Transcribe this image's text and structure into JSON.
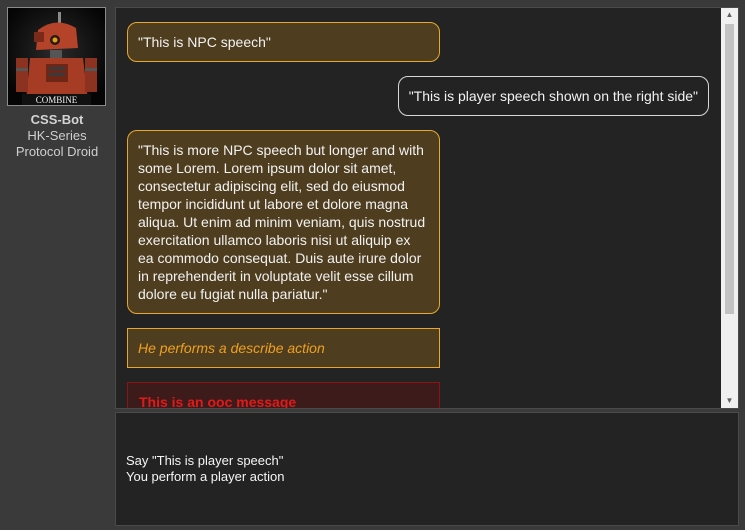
{
  "npc": {
    "avatar_icon": "droid-portrait-icon",
    "avatar_caption": "COMBINE",
    "name": "CSS-Bot",
    "series": "HK-Series",
    "role": "Protocol Droid"
  },
  "colors": {
    "npc_border": "#e8a82c",
    "npc_bg": "#4e3e1f",
    "action_text": "#f0a020",
    "ooc_text": "#e01a1a",
    "ooc_border": "#8b1515",
    "panel_bg": "#232323",
    "page_bg": "#3a3a3a"
  },
  "chat": {
    "messages": [
      {
        "type": "npc_speech",
        "text": "\"This is NPC speech\""
      },
      {
        "type": "player_speech",
        "text": "\"This is player speech shown on the right side\""
      },
      {
        "type": "npc_speech",
        "text": "\"This is more NPC speech but longer and with some Lorem. Lorem ipsum dolor sit amet, consectetur adipiscing elit, sed do eiusmod tempor incididunt ut labore et dolore magna aliqua. Ut enim ad minim veniam, quis nostrud exercitation ullamco laboris nisi ut aliquip ex ea commodo consequat. Duis aute irure dolor in reprehenderit in voluptate velit esse cillum dolore eu fugiat nulla pariatur.\""
      },
      {
        "type": "describe_action",
        "text": "He performs a describe action"
      },
      {
        "type": "ooc",
        "text": "This is an ooc message"
      }
    ]
  },
  "input": {
    "lines": [
      "Say \"This is player speech\"",
      "You perform a player action"
    ]
  }
}
